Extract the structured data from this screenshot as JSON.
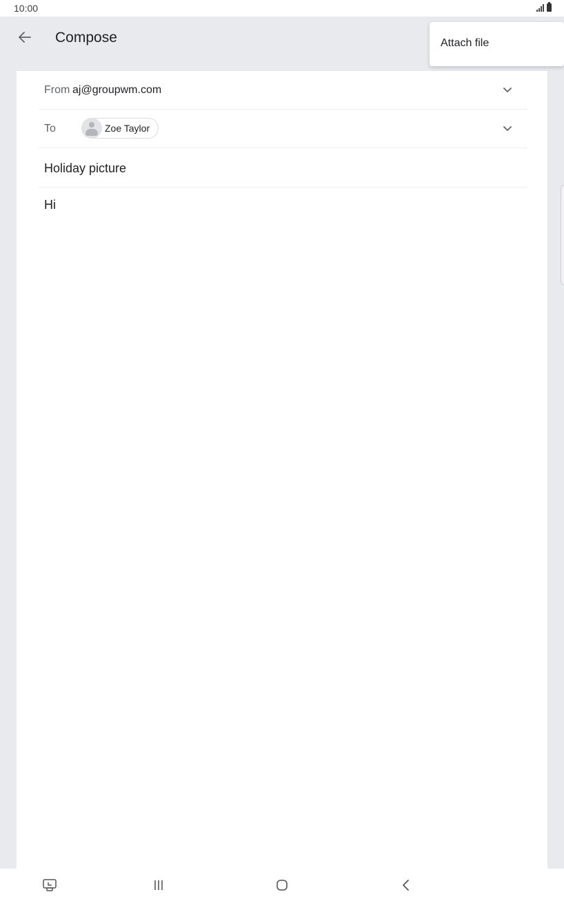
{
  "status_bar": {
    "time": "10:00",
    "icons": [
      "signal-icon",
      "battery-icon"
    ]
  },
  "app_bar": {
    "back_icon": "arrow-left-icon",
    "title": "Compose"
  },
  "overflow_menu": {
    "items": [
      {
        "label": "Attach file"
      }
    ]
  },
  "compose": {
    "from": {
      "label": "From",
      "value": "aj@groupwm.com",
      "dropdown_icon": "chevron-down-icon"
    },
    "to": {
      "label": "To",
      "recipients": [
        {
          "name": "Zoe Taylor",
          "avatar_icon": "person-icon"
        }
      ],
      "dropdown_icon": "chevron-down-icon"
    },
    "subject": "Holiday picture",
    "body": "Hi"
  },
  "nav_bar": {
    "buttons": [
      "screen-share-icon",
      "recent-apps-icon",
      "home-icon",
      "back-icon"
    ]
  },
  "colors": {
    "background": "#e9eaee",
    "card": "#ffffff",
    "text_primary": "#202124",
    "text_secondary": "#5f6368"
  }
}
